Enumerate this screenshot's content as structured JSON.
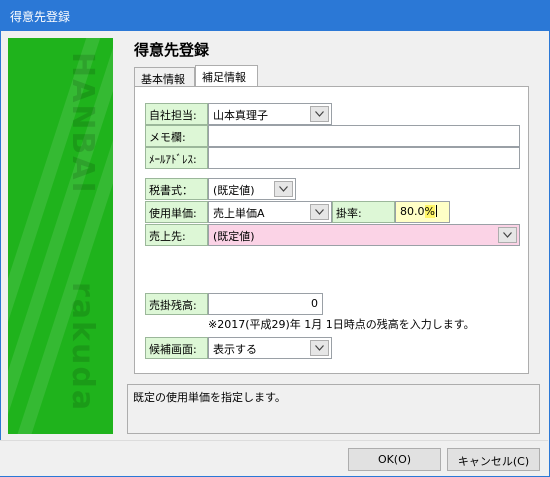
{
  "window": {
    "title": "得意先登録"
  },
  "form": {
    "title": "得意先登録"
  },
  "tabs": [
    {
      "label": "基本情報",
      "active": false
    },
    {
      "label": "補足情報",
      "active": true
    }
  ],
  "fields": {
    "staff": {
      "label": "自社担当:",
      "value": "山本真理子"
    },
    "memo": {
      "label": "メモ欄:",
      "value": ""
    },
    "email": {
      "label": "ﾒｰﾙｱﾄﾞﾚｽ:",
      "value": ""
    },
    "tax": {
      "label": "税書式：",
      "value": "(既定値)"
    },
    "unit_price": {
      "label": "使用単価:",
      "value": "売上単価A"
    },
    "rate": {
      "label": "掛率:",
      "value": "80.0",
      "selected_suffix": "%"
    },
    "sales_dest": {
      "label": "売上先:",
      "value": "(既定値)"
    },
    "receivable": {
      "label": "売掛残高:",
      "value": "0"
    },
    "candidate": {
      "label": "候補画面:",
      "value": "表示する"
    }
  },
  "note": "※2017(平成29)年 1月 1日時点の残高を入力します。",
  "status_text": "既定の使用単価を指定します。",
  "buttons": {
    "ok": "OK(O)",
    "cancel": "キャンセル(C)"
  },
  "sidebar": {
    "watermark_top": "HANBAI",
    "watermark_bottom": "rakuda"
  },
  "colors": {
    "titlebar": "#2b78d6",
    "sidebar": "#1fb31c",
    "label_bg": "#ddf7d6",
    "pink_field": "#fbd3e6",
    "yellow_field": "#ffffc6"
  },
  "icons": {
    "dropdown": "chevron-down-icon"
  }
}
